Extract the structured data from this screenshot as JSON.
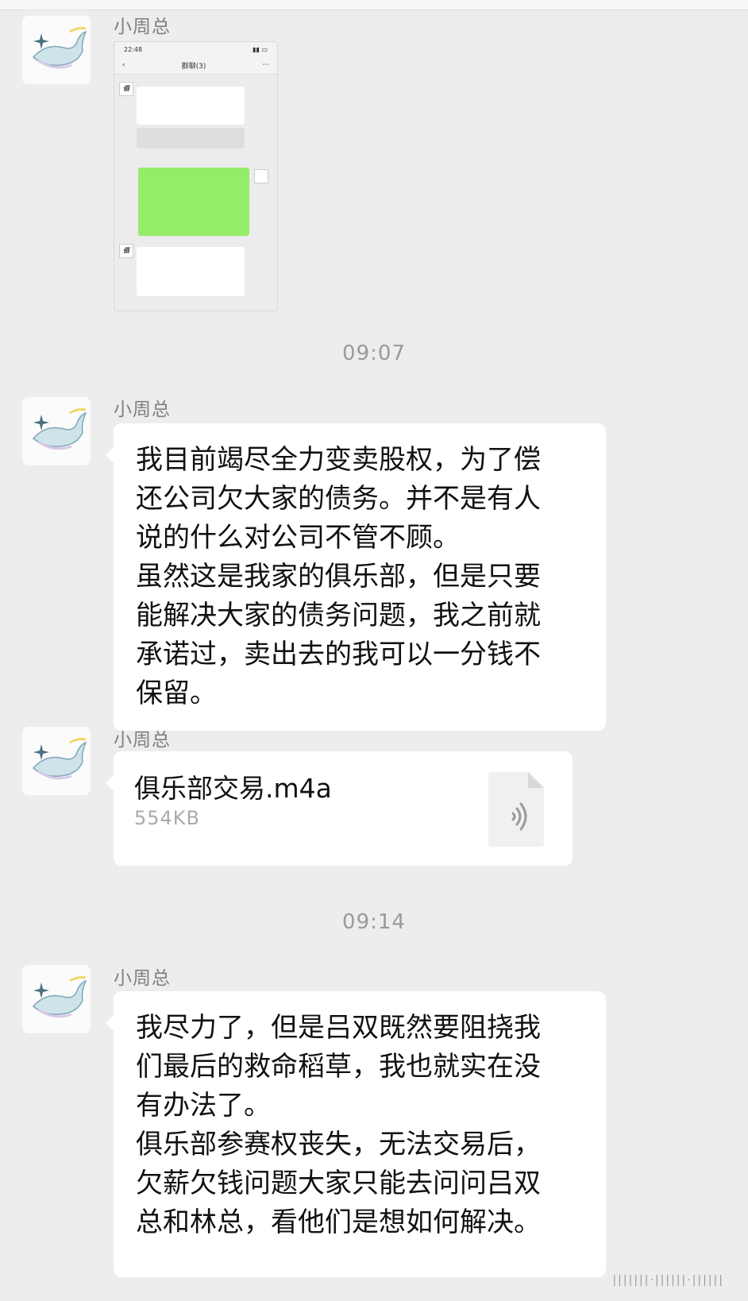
{
  "messages": {
    "sender": "小周总",
    "time1": "09:07",
    "time2": "09:14",
    "text1": "我目前竭尽全力变卖股权，为了偿\n还公司欠大家的债务。并不是有人\n说的什么对公司不管不顾。\n虽然这是我家的俱乐部，但是只要\n能解决大家的债务问题，我之前就\n承诺过，卖出去的我可以一分钱不\n保留。",
    "file_name": "俱乐部交易.m4a",
    "file_size": "554KB",
    "text2": "我尽力了，但是吕双既然要阻挠我\n们最后的救命稻草，我也就实在没\n有办法了。\n俱乐部参赛权丧失，无法交易后，\n欠薪欠钱问题大家只能去问问吕双\n总和林总，看他们是想如何解决。"
  },
  "embedded_screenshot": {
    "status_time": "22:48",
    "chat_title": "群聊(3)"
  },
  "colors": {
    "background": "#ededed",
    "bubble": "#ffffff",
    "green_bubble": "#95ec69"
  }
}
